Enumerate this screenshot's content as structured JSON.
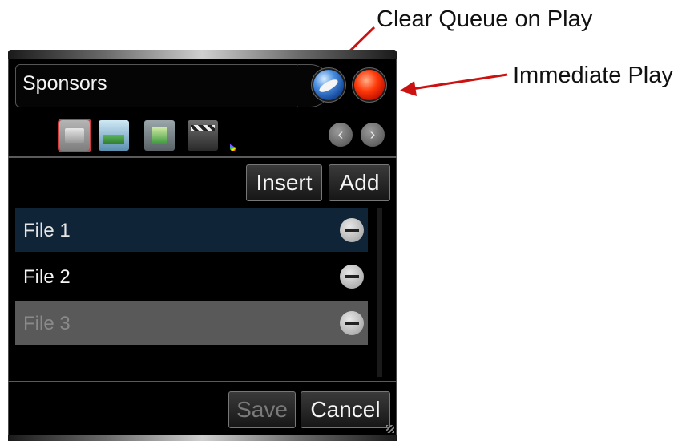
{
  "callouts": {
    "clear_queue": "Clear Queue on Play",
    "immediate_play": "Immediate Play"
  },
  "panel": {
    "title": "Sponsors",
    "toolbar_icons": [
      "folder-icon",
      "image-icon",
      "video-icon",
      "clapper-icon",
      "palette-icon"
    ],
    "nav": {
      "prev_icon": "chevron-left-icon",
      "next_icon": "chevron-right-icon",
      "prev_glyph": "‹",
      "next_glyph": "›"
    },
    "buttons": {
      "insert": "Insert",
      "add": "Add",
      "save": "Save",
      "cancel": "Cancel"
    },
    "items": [
      {
        "label": "File 1",
        "state": "selected"
      },
      {
        "label": "File 2",
        "state": "normal"
      },
      {
        "label": "File 3",
        "state": "disabled"
      }
    ]
  },
  "colors": {
    "arrow": "#cc1111",
    "selected_row": "#0f2436",
    "disabled_row": "#595959",
    "clear_queue_orb": "#2f6ad0",
    "immediate_play_orb": "#ff2a00"
  }
}
